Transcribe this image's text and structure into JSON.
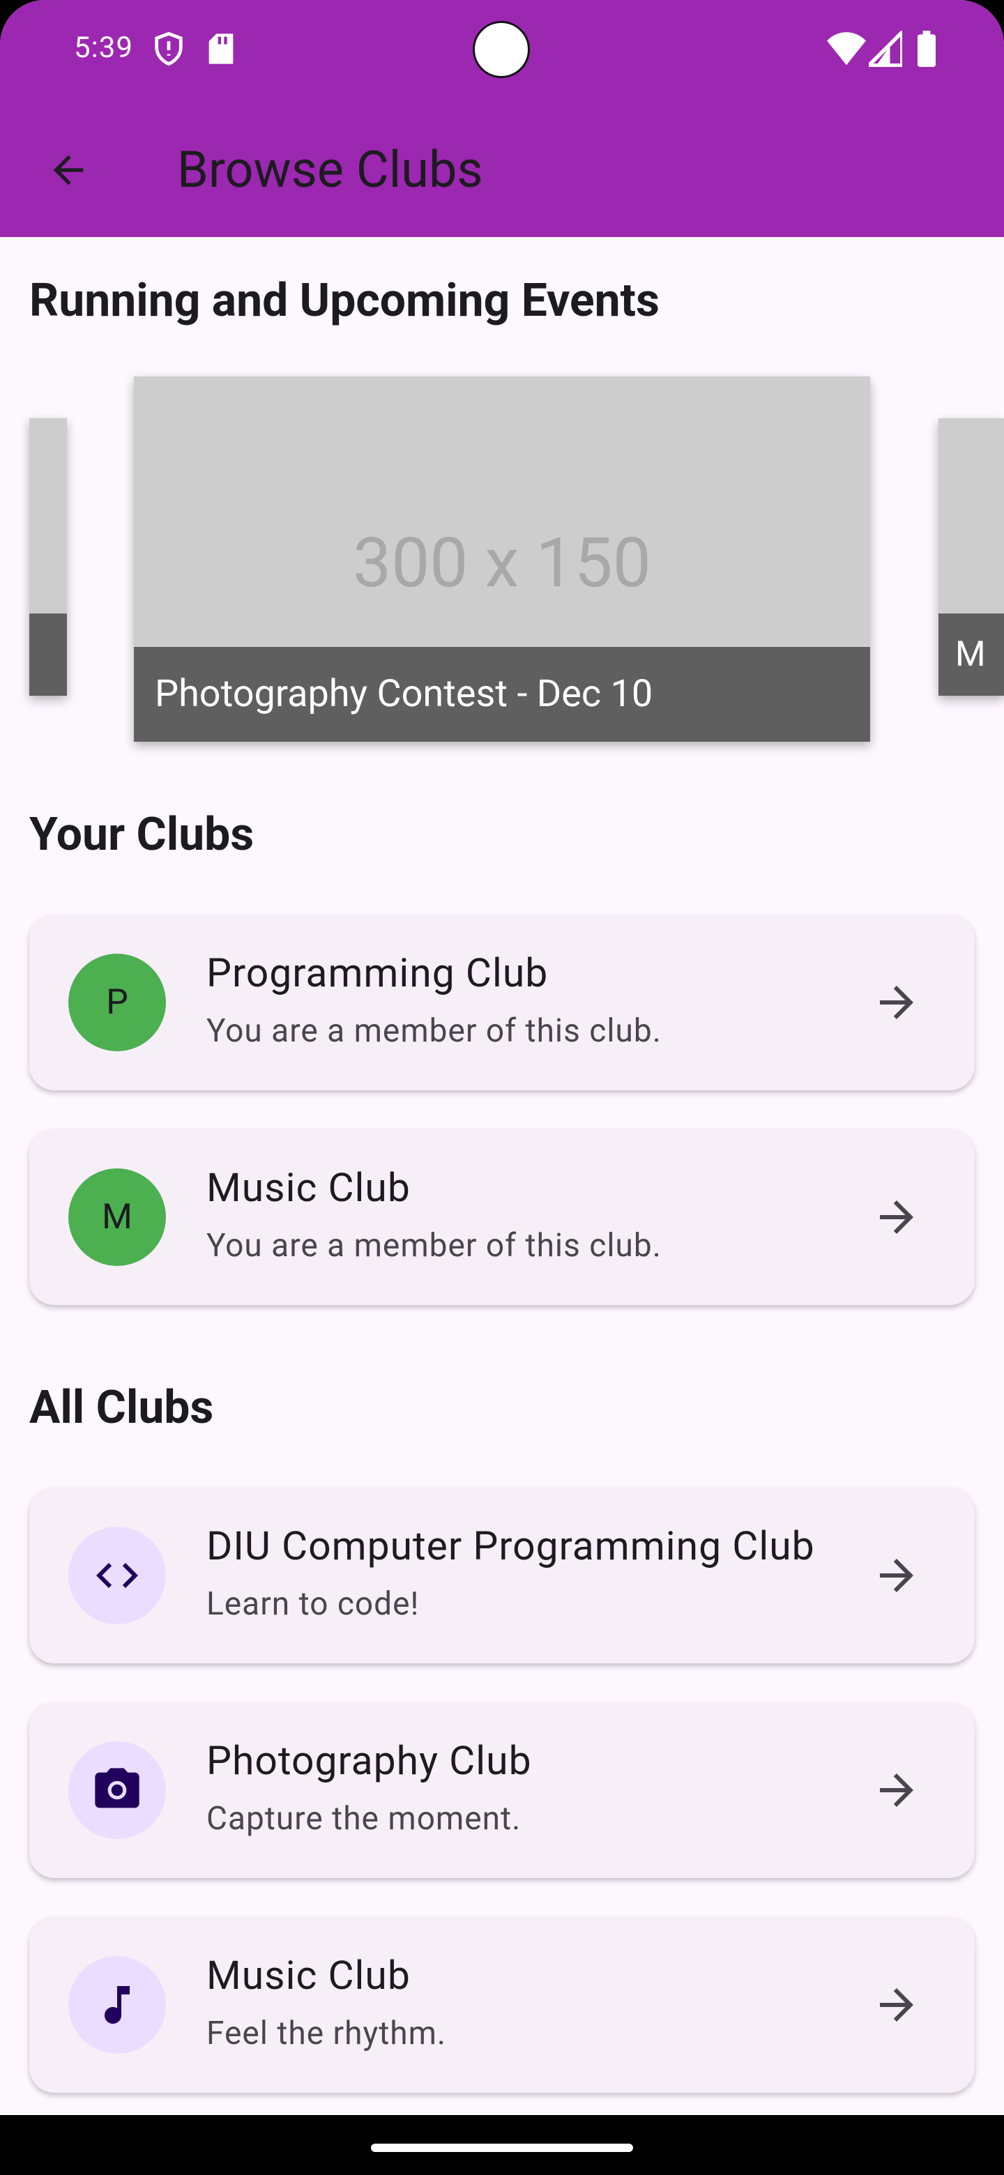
{
  "status_bar": {
    "time": "5:39"
  },
  "app_bar": {
    "title": "Browse Clubs",
    "back_icon": "arrow-back-icon"
  },
  "events_section": {
    "title": "Running and Upcoming Events",
    "main_card": {
      "image_placeholder": "300 x 150",
      "caption": "Photography Contest - Dec 10"
    },
    "next_card_caption_fragment": "M"
  },
  "your_clubs": {
    "title": "Your Clubs",
    "items": [
      {
        "initial": "P",
        "name": "Programming Club",
        "subtitle": "You are a member of this club."
      },
      {
        "initial": "M",
        "name": "Music Club",
        "subtitle": "You are a member of this club."
      }
    ]
  },
  "all_clubs": {
    "title": "All Clubs",
    "items": [
      {
        "icon": "code-icon",
        "name": "DIU Computer Programming Club",
        "subtitle": "Learn to code!"
      },
      {
        "icon": "camera-icon",
        "name": "Photography Club",
        "subtitle": "Capture the moment."
      },
      {
        "icon": "music-note-icon",
        "name": "Music Club",
        "subtitle": "Feel the rhythm."
      }
    ]
  },
  "colors": {
    "app_bar": "#9C27B0",
    "background": "#FDF7FE",
    "card": "#F6EFF7",
    "member_avatar": "#4CAF50",
    "icon_avatar": "#EADDFF",
    "caption_band": "#5F5F5F"
  }
}
